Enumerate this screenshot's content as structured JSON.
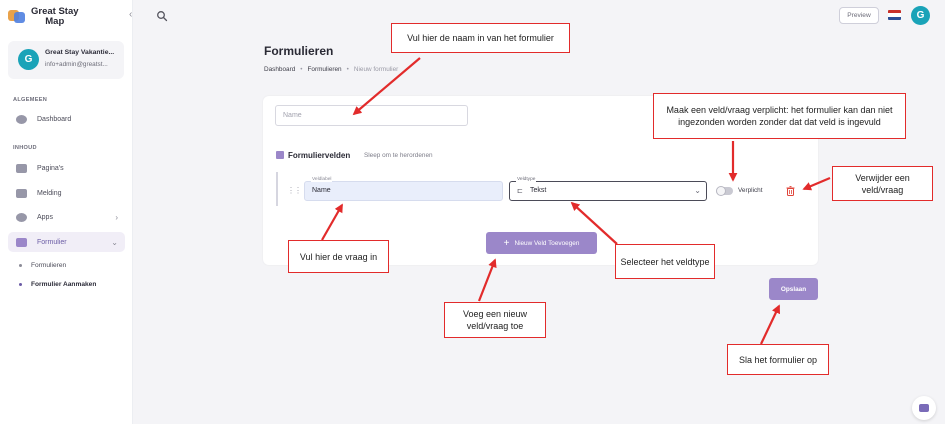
{
  "sidebar": {
    "logo_line1": "Great Stay",
    "logo_line2": "Map",
    "user": {
      "initial": "G",
      "name": "Great Stay Vakantie...",
      "email": "info+admin@greatst..."
    },
    "sections": {
      "general": "ALGEMEEN",
      "content": "INHOUD"
    },
    "items": {
      "dashboard": "Dashboard",
      "pages": "Pagina's",
      "notification": "Melding",
      "apps": "Apps",
      "forms": "Formulier"
    },
    "sub_items": {
      "forms": "Formulieren",
      "create_form": "Formulier Aanmaken"
    }
  },
  "header": {
    "preview": "Preview",
    "avatar_initial": "G"
  },
  "page": {
    "title": "Formulieren",
    "breadcrumb": [
      "Dashboard",
      "Formulieren",
      "Nieuw formulier"
    ]
  },
  "form": {
    "name_placeholder": "Name",
    "fields_title": "Formuliervelden",
    "fields_hint": "Sleep om te herordenen",
    "field": {
      "label_caption": "Veldlabel",
      "label_value": "Name",
      "type_caption": "Veldtype",
      "type_value": "Tekst",
      "required_label": "Verplicht",
      "required": false
    },
    "add_button": "Nieuw Veld Toevoegen",
    "save_button": "Opslaan"
  },
  "annotations": {
    "name": "Vul hier de naam in van het formulier",
    "required": "Maak een veld/vraag verplicht: het formulier kan dan niet ingezonden worden zonder dat dat veld is ingevuld",
    "delete": "Verwijder een veld/vraag",
    "question": "Vul hier de vraag in",
    "type": "Selecteer het veldtype",
    "add": "Voeg een nieuw veld/vraag toe",
    "save": "Sla het formulier op"
  },
  "colors": {
    "accent": "#9b87c9",
    "annotation_red": "#e22b2b",
    "avatar": "#1aa3b8"
  }
}
